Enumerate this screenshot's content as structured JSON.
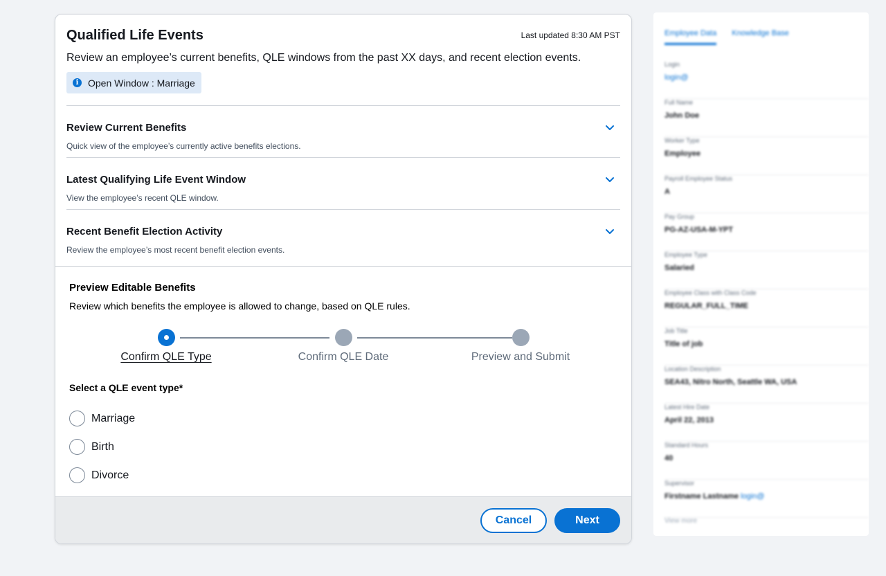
{
  "card": {
    "title": "Qualified Life Events",
    "last_updated": "Last updated 8:30 AM PST",
    "description": "Review an employee’s current benefits, QLE windows from the past XX days, and recent election events.",
    "info_chip": "Open Window : Marriage"
  },
  "sections": [
    {
      "title": "Review Current Benefits",
      "subtitle": "Quick view of the employee’s currently active benefits elections."
    },
    {
      "title": "Latest Qualifying Life Event Window",
      "subtitle": "View the employee’s recent QLE window."
    },
    {
      "title": "Recent Benefit Election Activity",
      "subtitle": "Review the employee’s most recent benefit election events."
    }
  ],
  "preview": {
    "title": "Preview Editable Benefits",
    "description": "Review which benefits the employee is allowed to change, based on QLE rules.",
    "steps": [
      {
        "label": "Confirm QLE Type",
        "state": "active"
      },
      {
        "label": "Confirm QLE Date",
        "state": "inactive"
      },
      {
        "label": "Preview and Submit",
        "state": "inactive"
      }
    ],
    "select_label": "Select a QLE event type*",
    "options": [
      "Marriage",
      "Birth",
      "Divorce"
    ]
  },
  "footer": {
    "cancel_label": "Cancel",
    "next_label": "Next"
  },
  "side_panel": {
    "tabs": [
      "Employee Data",
      "Knowledge Base"
    ],
    "fields": [
      {
        "label": "Login",
        "value": "login@"
      },
      {
        "label": "Full Name",
        "value": "John Doe"
      },
      {
        "label": "Worker Type",
        "value": "Employee"
      },
      {
        "label": "Payroll Employee Status",
        "value": "A"
      },
      {
        "label": "Pay Group",
        "value": "PG-AZ-USA-M-YPT"
      },
      {
        "label": "Employee Type",
        "value": "Salaried"
      },
      {
        "label": "Employee Class with Class Code",
        "value": "REGULAR_FULL_TIME"
      },
      {
        "label": "Job Title",
        "value": "Title of job"
      },
      {
        "label": "Location Description",
        "value": "SEA43, Nitro North, Seattle WA, USA"
      },
      {
        "label": "Latest Hire Date",
        "value": "April 22, 2013"
      },
      {
        "label": "Standard Hours",
        "value": "40"
      },
      {
        "label": "Supervisor",
        "value": "Firstname Lastname",
        "link": "login@"
      }
    ],
    "view_more": "View more"
  },
  "colors": {
    "accent": "#0972d3",
    "info_bg": "#dde9f7",
    "inactive_step": "#9ba7b6",
    "footer_bg": "#e9ebed"
  },
  "icons": [
    "info-icon",
    "chevron-down-icon"
  ]
}
